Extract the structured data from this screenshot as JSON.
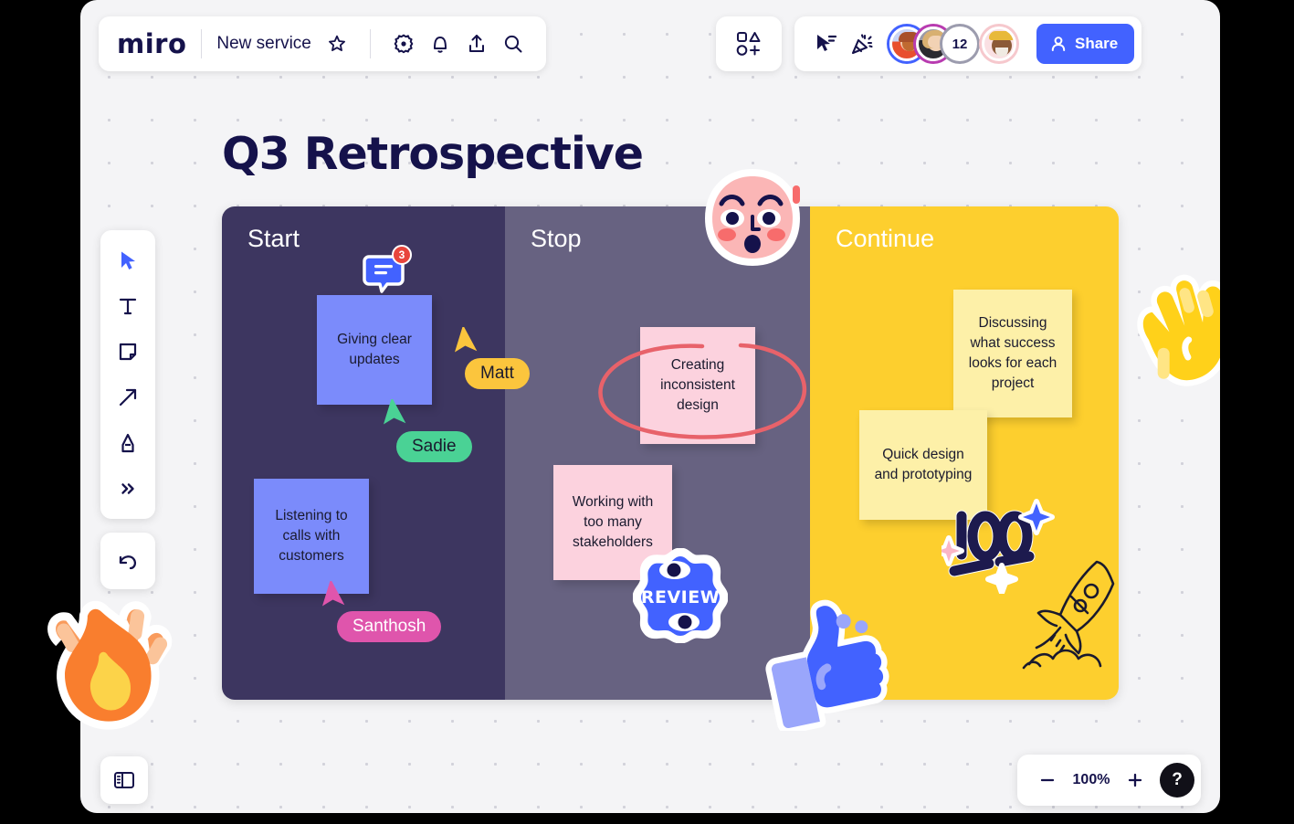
{
  "app": {
    "logo": "miro",
    "board_name": "New service",
    "zoom_level": "100%"
  },
  "header": {
    "left_icons": [
      {
        "name": "star-icon",
        "label": "Favorite"
      },
      {
        "name": "gear-icon",
        "label": "Settings"
      },
      {
        "name": "bell-icon",
        "label": "Notifications"
      },
      {
        "name": "upload-icon",
        "label": "Upload"
      },
      {
        "name": "search-icon",
        "label": "Search"
      }
    ],
    "shapes_button": "shapes-templates-icon",
    "right_icons": [
      {
        "name": "cursor-select-icon",
        "label": "Presentation cursor"
      },
      {
        "name": "party-popper-icon",
        "label": "Celebrate"
      }
    ],
    "avatars": [
      {
        "name": "avatar-collaborator-1",
        "ring": "#4262ff"
      },
      {
        "name": "avatar-collaborator-2",
        "ring": "#b83bb0"
      },
      {
        "name": "avatar-overflow-count",
        "ring": "#9c9cae",
        "count": "12"
      },
      {
        "name": "avatar-current-user",
        "ring": "#f6c8cd"
      }
    ],
    "share_label": "Share"
  },
  "toolbar": {
    "tools": [
      {
        "name": "select-tool",
        "icon": "cursor-icon",
        "active": true
      },
      {
        "name": "text-tool",
        "icon": "text-icon",
        "active": false
      },
      {
        "name": "sticky-note-tool",
        "icon": "sticky-note-icon",
        "active": false
      },
      {
        "name": "arrow-tool",
        "icon": "arrow-icon",
        "active": false
      },
      {
        "name": "pen-tool",
        "icon": "pen-icon",
        "active": false
      },
      {
        "name": "more-tools",
        "icon": "chevron-double-right-icon",
        "active": false
      }
    ],
    "undo": {
      "name": "undo-button",
      "icon": "undo-arrow-icon"
    },
    "panel_toggle": {
      "name": "panel-toggle-button",
      "icon": "sidebar-panel-icon"
    }
  },
  "board": {
    "title": "Q3 Retrospective",
    "comment": {
      "count": "3"
    },
    "columns": [
      {
        "title": "Start",
        "color": "#3d3660"
      },
      {
        "title": "Stop",
        "color": "#676281"
      },
      {
        "title": "Continue",
        "color": "#fdcf2e"
      }
    ],
    "stickies": [
      {
        "id": "s1",
        "text": "Giving clear updates",
        "color": "#7b8bfb",
        "column": "Start"
      },
      {
        "id": "s2",
        "text": "Listening to calls with customers",
        "color": "#7b8bfb",
        "column": "Start"
      },
      {
        "id": "s3",
        "text": "Creating inconsistent design",
        "color": "#fcd2de",
        "column": "Stop"
      },
      {
        "id": "s4",
        "text": "Working with too many stakeholders",
        "color": "#fcd2de",
        "column": "Stop"
      },
      {
        "id": "s5",
        "text": "Discussing what success looks for each project",
        "color": "#fdf0a8",
        "column": "Continue"
      },
      {
        "id": "s6",
        "text": "Quick design and prototyping",
        "color": "#fdf0a8",
        "column": "Continue"
      }
    ],
    "cursors": [
      {
        "name": "Matt",
        "bg": "#fbc53d",
        "fg": "#1a1a2e"
      },
      {
        "name": "Sadie",
        "bg": "#4ad295",
        "fg": "#1a1a2e"
      },
      {
        "name": "Santhosh",
        "bg": "#df55ac",
        "fg": "#ffffff"
      }
    ],
    "stickers": [
      {
        "name": "surprised-face-sticker"
      },
      {
        "name": "clapping-hands-sticker"
      },
      {
        "name": "fire-sticker"
      },
      {
        "name": "review-badge-sticker",
        "text": "REVIEW"
      },
      {
        "name": "thumbs-up-sticker"
      },
      {
        "name": "hundred-points-sticker",
        "text": "100"
      },
      {
        "name": "rocket-drawing"
      },
      {
        "name": "red-ellipse-annotation"
      }
    ]
  },
  "zoom_controls": {
    "zoom_out": "−",
    "zoom_in": "+",
    "level": "100%",
    "help": "?"
  }
}
